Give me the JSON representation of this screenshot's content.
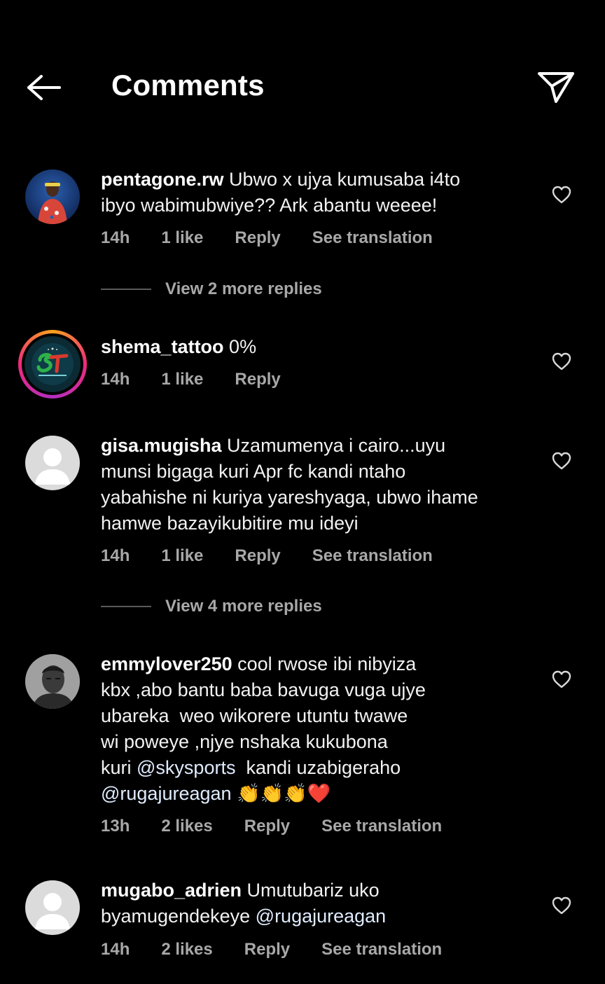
{
  "header": {
    "title": "Comments",
    "back_icon": "arrow-left-icon",
    "share_icon": "paper-plane-icon"
  },
  "comments": [
    {
      "username": "pentagone.rw",
      "text": " Ubwo x ujya kumusaba i4to\nibyo wabimubwiye?? Ark abantu weeee!",
      "time": "14h",
      "likes": "1 like",
      "reply": "Reply",
      "translate": "See translation",
      "view_replies": "View 2 more replies"
    },
    {
      "username": "shema_tattoo",
      "text": " 0%",
      "time": "14h",
      "likes": "1 like",
      "reply": "Reply"
    },
    {
      "username": "gisa.mugisha",
      "text": " Uzamumenya i cairo...uyu\nmunsi bigaga kuri Apr fc kandi ntaho\nyabahishe ni kuriya yareshyaga, ubwo ihame\nhamwe bazayikubitire mu ideyi",
      "time": "14h",
      "likes": "1 like",
      "reply": "Reply",
      "translate": "See translation",
      "view_replies": "View 4 more replies"
    },
    {
      "username": "emmylover250",
      "text_before": " cool rwose ibi nibyiza\nkbx ,abo bantu baba bavuga vuga ujye\nubareka  weo wikorere utuntu twawe\nwi poweye ,njye nshaka kukubona\nkuri ",
      "mention1": "@skysports",
      "text_middle": "  kandi uzabigeraho\n",
      "mention2": "@rugajureagan",
      "text_after": " 👏👏👏❤️",
      "time": "13h",
      "likes": "2 likes",
      "reply": "Reply",
      "translate": "See translation"
    },
    {
      "username": "mugabo_adrien",
      "text_before": " Umutubariz uko\nbyamugendekeye ",
      "mention1": "@rugajureagan",
      "time": "14h",
      "likes": "2 likes",
      "reply": "Reply",
      "translate": "See translation"
    }
  ],
  "colors": {
    "background": "#000000",
    "text": "#f2f2f2",
    "muted": "#a8a8a8",
    "story_ring": "#ee2a7b"
  }
}
